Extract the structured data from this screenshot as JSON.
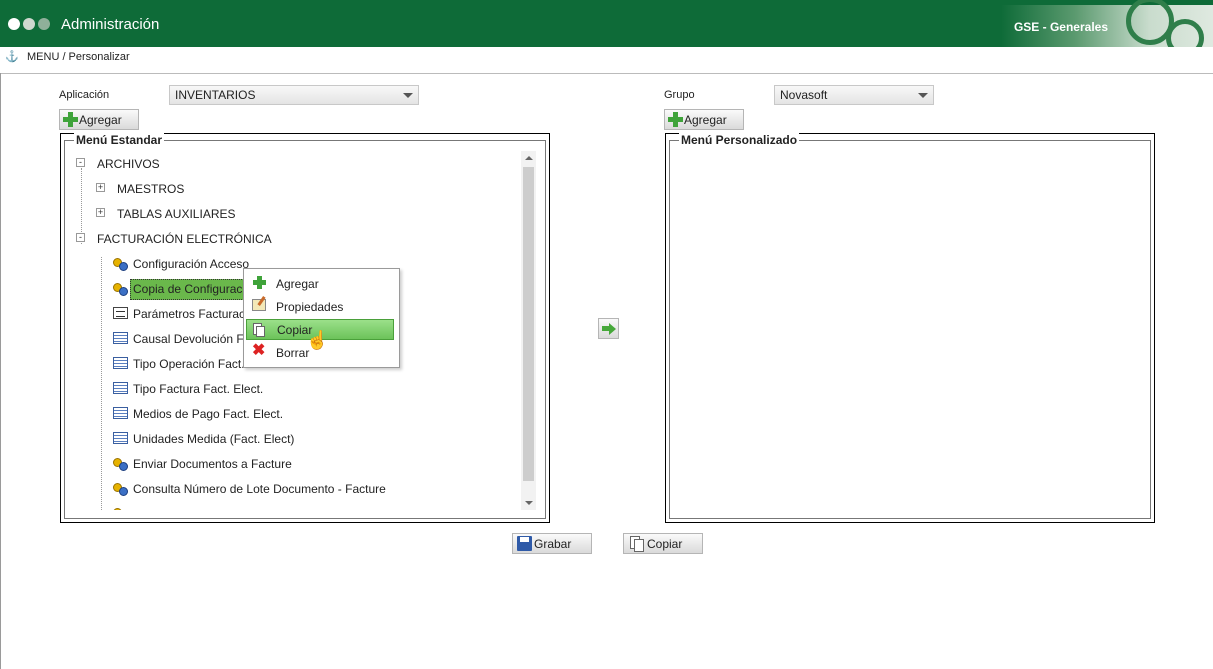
{
  "header": {
    "title": "Administración",
    "brand": "GSE - Generales"
  },
  "breadcrumb": "MENU / Personalizar",
  "form": {
    "aplicacion_label": "Aplicación",
    "aplicacion_value": "INVENTARIOS",
    "grupo_label": "Grupo",
    "grupo_value": "Novasoft",
    "agregar_label": "Agregar"
  },
  "menu_estandar": {
    "title": "Menú Estandar",
    "nodes": [
      {
        "label": "ARCHIVOS",
        "expander": "-"
      },
      {
        "label": "MAESTROS",
        "expander": "+"
      },
      {
        "label": "TABLAS AUXILIARES",
        "expander": "+"
      },
      {
        "label": "FACTURACIÓN ELECTRÓNICA",
        "expander": "-"
      },
      {
        "label": "Configuración Acceso",
        "icon": "key-icon"
      },
      {
        "label": "Copia de Configurac",
        "icon": "key-icon"
      },
      {
        "label": "Parámetros Facturaci",
        "icon": "form-icon"
      },
      {
        "label": "Causal Devolución Fa",
        "icon": "table-icon"
      },
      {
        "label": "Tipo Operación Fact. Elect.",
        "icon": "table-icon"
      },
      {
        "label": "Tipo Factura Fact. Elect.",
        "icon": "table-icon"
      },
      {
        "label": "Medios de Pago Fact. Elect.",
        "icon": "table-icon"
      },
      {
        "label": "Unidades Medida (Fact. Elect)",
        "icon": "table-icon"
      },
      {
        "label": "Enviar Documentos a Facture",
        "icon": "key-icon"
      },
      {
        "label": "Consulta Número de Lote Documento - Facture",
        "icon": "key-icon"
      }
    ]
  },
  "menu_personalizado": {
    "title": "Menú Personalizado"
  },
  "context_menu": {
    "items": [
      "Agregar",
      "Propiedades",
      "Copiar",
      "Borrar"
    ]
  },
  "buttons": {
    "grabar": "Grabar",
    "copiar": "Copiar"
  },
  "colors": {
    "header": "#0e6b38",
    "selection": "#6ab84b"
  }
}
